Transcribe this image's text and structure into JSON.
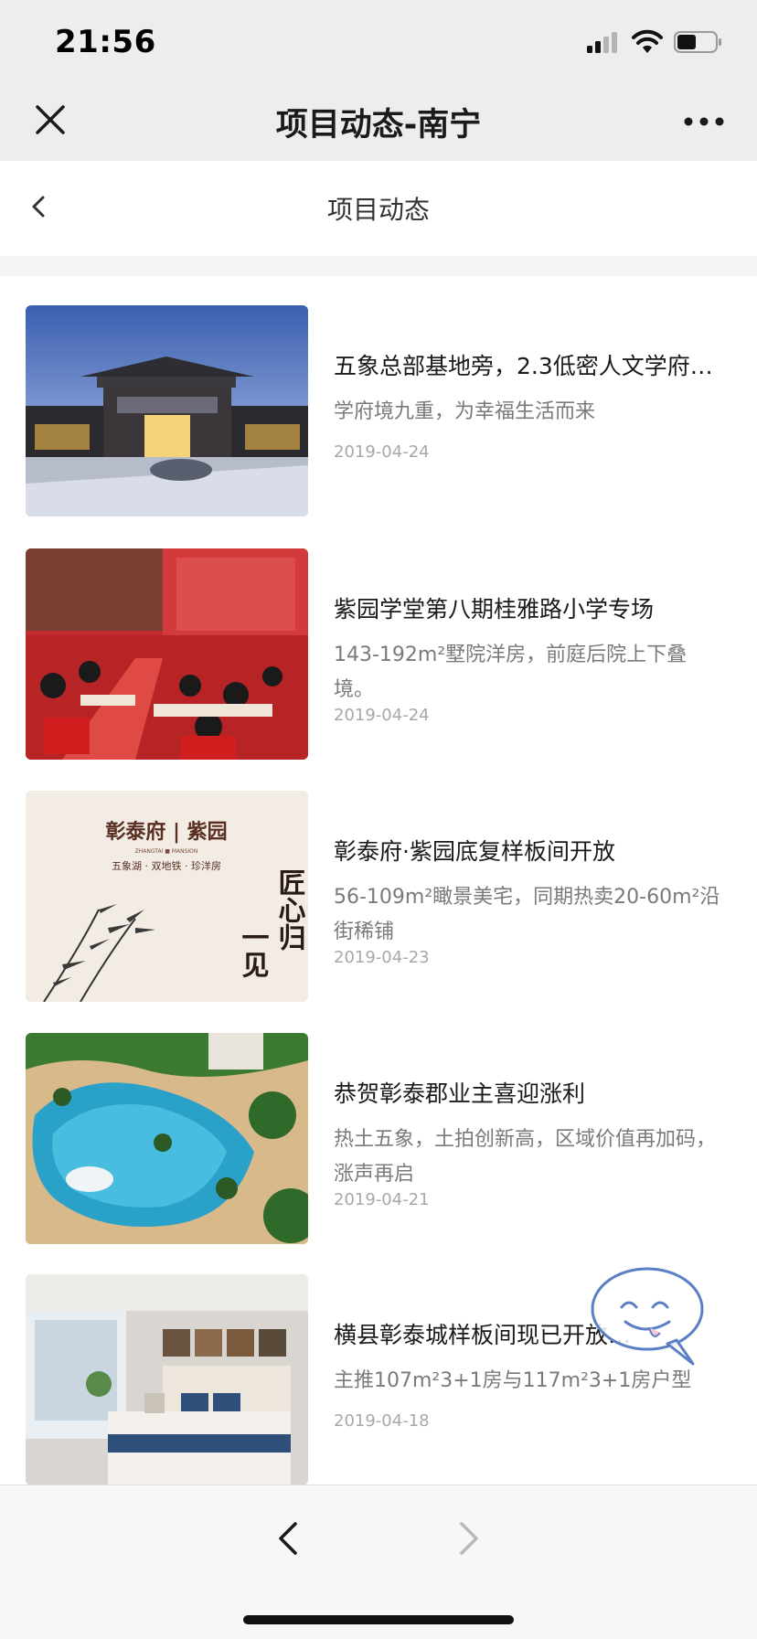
{
  "status_bar": {
    "time": "21:56",
    "icons": [
      "signal-icon",
      "wifi-icon",
      "battery-icon"
    ]
  },
  "nav": {
    "title": "项目动态-南宁",
    "close_icon": "close-icon",
    "more_icon": "more-icon"
  },
  "page": {
    "title": "项目动态",
    "back_icon": "chevron-left-icon"
  },
  "articles": [
    {
      "title": "五象总部基地旁，2.3低密人文学府…",
      "summary": "学府境九重，为幸福生活而来",
      "date": "2019-04-24",
      "image": "modern-building-at-dusk"
    },
    {
      "title": "紫园学堂第八期桂雅路小学专场",
      "summary": "143-192m²墅院洋房，前庭后院上下叠境。",
      "date": "2019-04-24",
      "image": "children-in-red-classroom"
    },
    {
      "title": "彰泰府·紫园底复样板间开放",
      "summary": "56-109m²瞰景美宅，同期热卖20-60m²沿街稀铺",
      "date": "2019-04-23",
      "image": "ink-bamboo-poster",
      "image_text": {
        "brand": "彰泰府 | 紫园",
        "brand_en": "ZHANGTAI ■ MANSION",
        "tagline": "五象湖 · 双地铁 · 珍洋房",
        "calligraphy_right": "匠心归",
        "calligraphy_left": "一见"
      }
    },
    {
      "title": "恭贺彰泰郡业主喜迎涨利",
      "summary": "热土五象，土拍创新高，区域价值再加码，涨声再启",
      "date": "2019-04-21",
      "image": "aerial-swimming-pool"
    },
    {
      "title": "横县彰泰城样板间现已开放…",
      "summary": "主推107m²3+1房与117m²3+1房户型",
      "date": "2019-04-18",
      "image": "bedroom-interior"
    }
  ],
  "toolbar": {
    "back_icon": "chevron-left-icon",
    "forward_icon": "chevron-right-icon"
  },
  "colors": {
    "nav_background": "#ededed",
    "title_text": "#1a1a1a",
    "summary_text": "#7a7a7a",
    "date_text": "#a8a8a8",
    "chat_bubble_stroke": "#5b7fc4"
  }
}
